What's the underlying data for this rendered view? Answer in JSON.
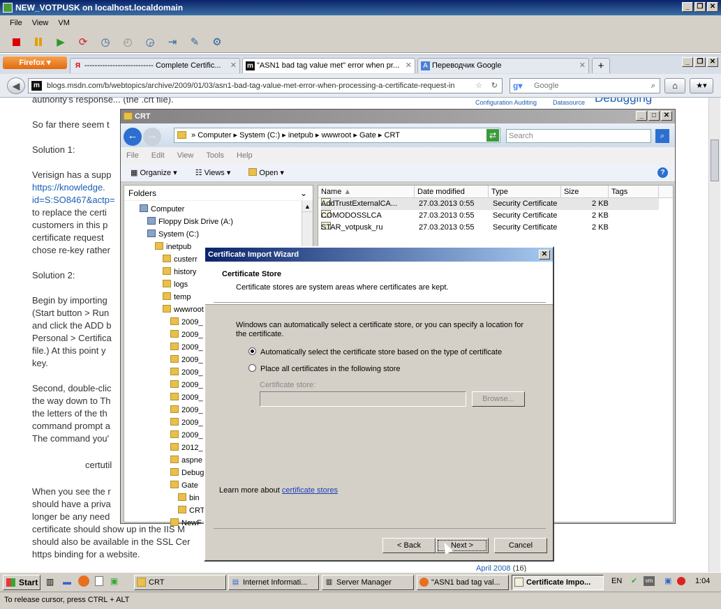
{
  "vm_window": {
    "title": "NEW_VOTPUSK on localhost.localdomain",
    "menu": [
      "File",
      "View",
      "VM"
    ],
    "toolbar_icons": [
      "stop-icon",
      "pause-icon",
      "play-icon",
      "reset-icon",
      "snapshot-icon",
      "snapshot-revert-icon",
      "snapshot-manager-icon",
      "quick-switch-icon",
      "preferences-icon",
      "settings-icon"
    ]
  },
  "firefox": {
    "menu_label": "Firefox",
    "tabs": [
      {
        "label": "--------------------------- Complete Certific...",
        "active": false
      },
      {
        "label": "\"ASN1 bad tag value met\" error when pr...",
        "active": true
      },
      {
        "label": "Переводчик Google",
        "active": false
      }
    ],
    "new_tab_label": "+",
    "url": "blogs.msdn.com/b/webtopics/archive/2009/01/03/asn1-bad-tag-value-met-error-when-processing-a-certificate-request-in",
    "favicon_text": "m",
    "search_placeholder": "Google"
  },
  "page": {
    "lines": [
      "authority's response... (the .crt file).",
      "So far there seem t",
      "Solution 1:",
      "Verisign has a supp",
      "https://knowledge.",
      "id=S:SO8467&actp=",
      "to replace the certi",
      "customers in this p",
      "certificate request",
      "chose re-key rather",
      "Solution 2:",
      "Begin by importing",
      "(Start button > Run",
      "and click the ADD b",
      "Personal > Certifica",
      "file.)  At this point y",
      "key.",
      "Second, double-clic",
      "the way down to Th",
      "the letters of the th",
      "command prompt a",
      "The command you'",
      "certutil",
      "When you see the r",
      "should have a priva",
      "longer be any need",
      "certificate should show up in the IIS M",
      "should also be available in the SSL Cer",
      "https binding for a website."
    ],
    "side_links": [
      "Configuration Auditing",
      "Datasource"
    ],
    "side_heading": "Debugging",
    "archive_link": "April 2008",
    "archive_count": "(16)"
  },
  "explorer": {
    "title": "CRT",
    "breadcrumb": [
      "Computer",
      "System (C:)",
      "inetpub",
      "wwwroot",
      "Gate",
      "CRT"
    ],
    "search_placeholder": "Search",
    "menu": [
      "File",
      "Edit",
      "View",
      "Tools",
      "Help"
    ],
    "toolbar": [
      "Organize",
      "Views",
      "Open"
    ],
    "folders_label": "Folders",
    "tree": [
      {
        "label": "Computer",
        "indent": 0
      },
      {
        "label": "Floppy Disk Drive (A:)",
        "indent": 1
      },
      {
        "label": "System (C:)",
        "indent": 1
      },
      {
        "label": "inetpub",
        "indent": 2
      },
      {
        "label": "custerr",
        "indent": 3
      },
      {
        "label": "history",
        "indent": 3
      },
      {
        "label": "logs",
        "indent": 3
      },
      {
        "label": "temp",
        "indent": 3
      },
      {
        "label": "wwwroot",
        "indent": 3
      },
      {
        "label": "2009_",
        "indent": 4
      },
      {
        "label": "2009_",
        "indent": 4
      },
      {
        "label": "2009_",
        "indent": 4
      },
      {
        "label": "2009_",
        "indent": 4
      },
      {
        "label": "2009_",
        "indent": 4
      },
      {
        "label": "2009_",
        "indent": 4
      },
      {
        "label": "2009_",
        "indent": 4
      },
      {
        "label": "2009_",
        "indent": 4
      },
      {
        "label": "2009_",
        "indent": 4
      },
      {
        "label": "2009_",
        "indent": 4
      },
      {
        "label": "2012_",
        "indent": 4
      },
      {
        "label": "aspne",
        "indent": 4
      },
      {
        "label": "Debug",
        "indent": 4
      },
      {
        "label": "Gate",
        "indent": 4
      },
      {
        "label": "bin",
        "indent": 5
      },
      {
        "label": "CRT",
        "indent": 5
      },
      {
        "label": "NewF",
        "indent": 4
      }
    ],
    "columns": [
      "Name",
      "Date modified",
      "Type",
      "Size",
      "Tags"
    ],
    "files": [
      {
        "name": "AddTrustExternalCA...",
        "date": "27.03.2013 0:55",
        "type": "Security Certificate",
        "size": "2 KB"
      },
      {
        "name": "COMODOSSLCA",
        "date": "27.03.2013 0:55",
        "type": "Security Certificate",
        "size": "2 KB"
      },
      {
        "name": "STAR_votpusk_ru",
        "date": "27.03.2013 0:55",
        "type": "Security Certificate",
        "size": "2 KB"
      }
    ]
  },
  "wizard": {
    "title": "Certificate Import Wizard",
    "heading": "Certificate Store",
    "subheading": "Certificate stores are system areas where certificates are kept.",
    "description": "Windows can automatically select a certificate store, or you can specify a location for the certificate.",
    "option_auto": "Automatically select the certificate store based on the type of certificate",
    "option_manual": "Place all certificates in the following store",
    "store_label": "Certificate store:",
    "store_value": "",
    "browse_label": "Browse...",
    "learn_prefix": "Learn more about ",
    "learn_link": "certificate stores",
    "back_label": "< Back",
    "next_label": "Next >",
    "cancel_label": "Cancel"
  },
  "taskbar": {
    "start_label": "Start",
    "items": [
      {
        "label": "CRT",
        "active": false
      },
      {
        "label": "Internet Informati...",
        "active": false
      },
      {
        "label": "Server Manager",
        "active": false
      },
      {
        "label": "\"ASN1 bad tag val...",
        "active": false
      },
      {
        "label": "Certificate Impo...",
        "active": true
      }
    ],
    "lang": "EN",
    "clock": "1:04"
  },
  "status_bar": "To release cursor, press CTRL + ALT"
}
